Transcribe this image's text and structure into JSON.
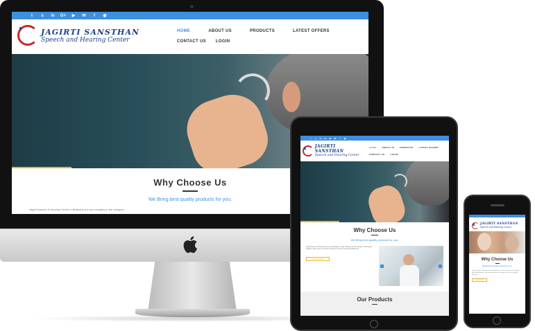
{
  "social_icons": [
    "twitter-icon",
    "skype-icon",
    "linkedin-icon",
    "google-plus-icon",
    "youtube-icon",
    "mail-icon",
    "facebook-icon",
    "chat-icon"
  ],
  "social_glyphs": [
    "t",
    "s",
    "in",
    "G+",
    "▶",
    "✉",
    "f",
    "◉"
  ],
  "logo": {
    "title": "JAGIRTI SANSTHAN",
    "subtitle": "Speech and Hearing Center"
  },
  "nav": [
    "HOME",
    "ABOUT US",
    "PRODUCTS",
    "LATEST OFFERS",
    "CONTACT US",
    "LOGIN"
  ],
  "why": {
    "title": "Why Choose Us",
    "subtitle": "We Bring best quality products for you."
  },
  "tablet": {
    "intro": "Jagirti Speech & Hearing Centre in Bhilwara is a top company in the category Hearing Aid Dealers, also known for Speech Therapy Centres, Hearing Aid Batteries.",
    "read_more": "READ MORE",
    "products_title": "Our Products"
  },
  "desktop_peek": "Jagirti Speech & Hearing Centre in Bhilwara is a top company in the category",
  "colors": {
    "accent": "#3d8fe0",
    "brand": "#1c3e8a",
    "logo_red": "#c62828",
    "highlight": "#f0b428"
  }
}
